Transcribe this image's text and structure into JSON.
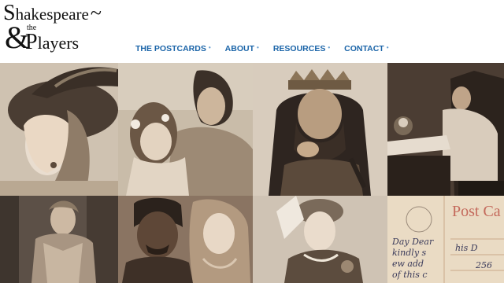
{
  "logo": {
    "line1_first": "S",
    "line1_rest": "hakespeare",
    "tilde": "~",
    "amp": "&",
    "the": "the",
    "players_first": "P",
    "players_rest": "layers"
  },
  "nav": {
    "items": [
      {
        "label": "THE POSTCARDS",
        "dot": "•"
      },
      {
        "label": "ABOUT",
        "dot": "•"
      },
      {
        "label": "RESOURCES",
        "dot": "•"
      },
      {
        "label": "CONTACT",
        "dot": "•"
      }
    ]
  },
  "postcard": {
    "stamp_text": "Post Ca",
    "handwriting": [
      "Day Dear",
      "kindly s",
      "ew add",
      "of this c",
      "his D",
      "256"
    ]
  },
  "colors": {
    "nav_link": "#1a64a8",
    "sepia_light": "#e8ddd0",
    "sepia_mid": "#b8a48a",
    "sepia_dark": "#5a4636"
  }
}
